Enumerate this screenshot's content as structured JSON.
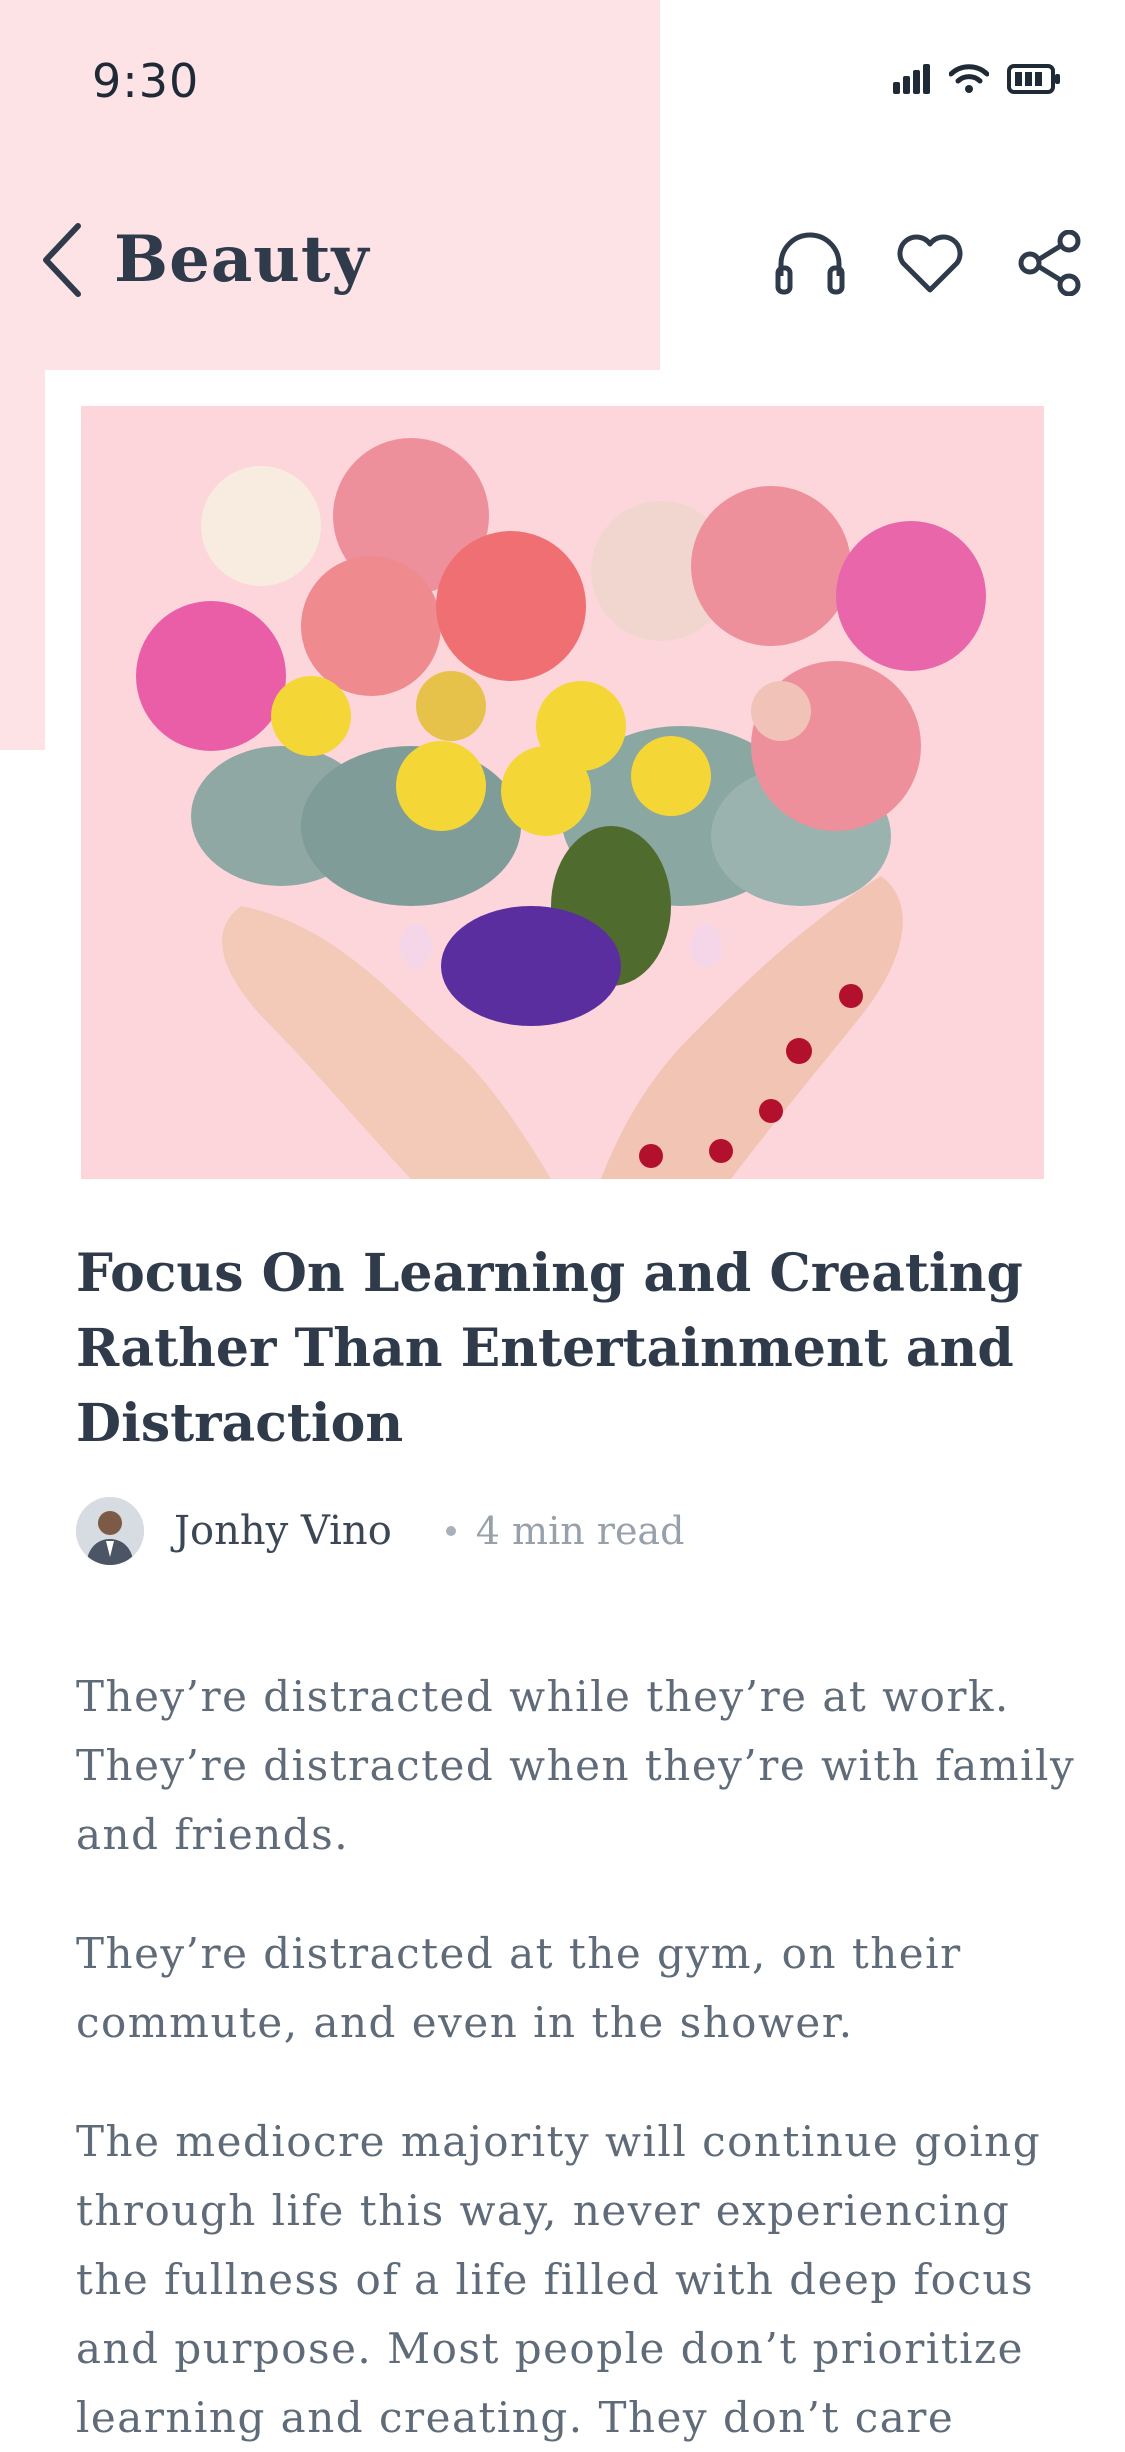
{
  "status_bar": {
    "time": "9:30",
    "icons": [
      "signal-icon",
      "wifi-icon",
      "battery-icon"
    ]
  },
  "nav": {
    "title": "Beauty",
    "actions": [
      "headphones-icon",
      "heart-icon",
      "share-icon"
    ]
  },
  "article": {
    "hero_image": "heart-shaped-flower-bouquet-in-hands",
    "title": "Focus On Learning and Creating Rather Than Entertainment and Distraction",
    "author": "Jonhy Vino",
    "read_time": "4 min read",
    "paragraphs": [
      "They’re distracted while they’re at work. They’re distracted when they’re with family and friends.",
      "They’re distracted at the gym, on their commute, and even in the shower.",
      "The mediocre majority will continue going through life this way, never experiencing the fullness of a life filled with deep focus and purpose. Most people don’t prioritize learning and creating. They don’t care"
    ]
  },
  "colors": {
    "header_pink": "#fde3e6",
    "image_pink": "#fdd6dc",
    "title_text": "#2f3b4b",
    "body_text": "#5f6b78"
  }
}
